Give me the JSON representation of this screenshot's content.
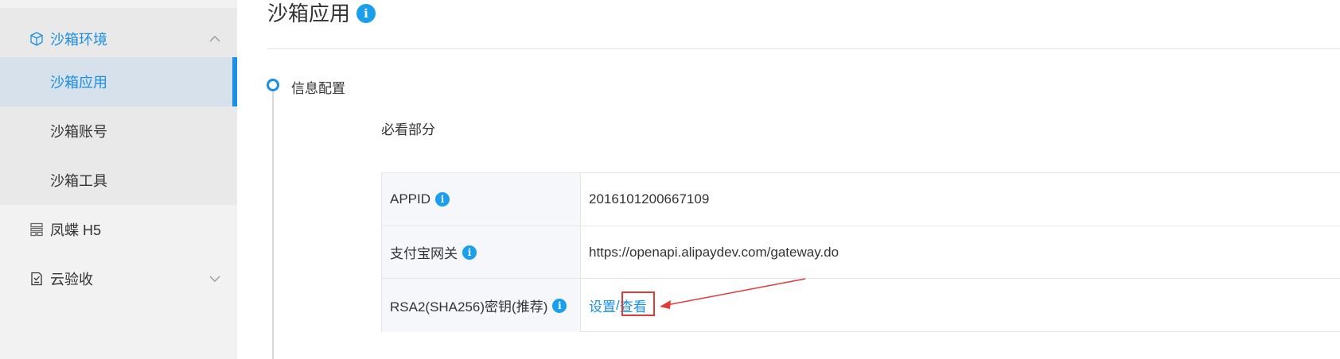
{
  "sidebar": {
    "group": {
      "label": "沙箱环境",
      "icon": "cube-icon"
    },
    "subitems": [
      {
        "label": "沙箱应用"
      },
      {
        "label": "沙箱账号"
      },
      {
        "label": "沙箱工具"
      }
    ],
    "items": [
      {
        "label": "凤蝶 H5",
        "icon": "layout-icon"
      },
      {
        "label": "云验收",
        "icon": "document-check-icon"
      }
    ]
  },
  "main": {
    "title": "沙箱应用",
    "step_title": "信息配置",
    "section_title": "必看部分",
    "rows": [
      {
        "key": "APPID",
        "value": "2016101200667109"
      },
      {
        "key": "支付宝网关",
        "value": "https://openapi.alipaydev.com/gateway.do"
      },
      {
        "key": "RSA2(SHA256)密钥(推荐)",
        "link_set": "设置",
        "separator": "/",
        "link_view": "查看"
      }
    ]
  },
  "colors": {
    "accent": "#1a8fe3",
    "info_badge": "#1a9fef",
    "annotation_red": "#e53935",
    "sidebar_bg": "#f2f2f2",
    "sidebar_active_bg": "#d6e1ec"
  }
}
